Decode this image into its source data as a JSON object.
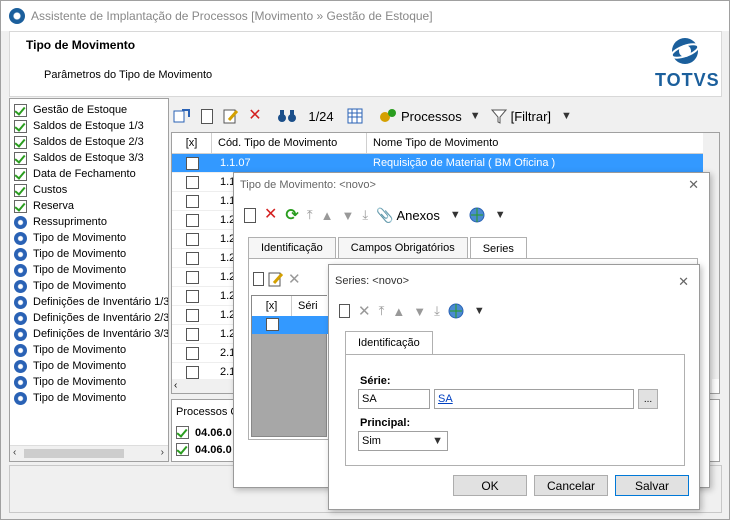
{
  "window": {
    "title": "Assistente de Implantação de Processos [Movimento » Gestão de Estoque]"
  },
  "header": {
    "title": "Tipo de Movimento",
    "subtitle": "Parâmetros do Tipo de Movimento",
    "logo": "TOTVS"
  },
  "tree": {
    "items": [
      {
        "label": "Gestão de Estoque",
        "icon": "check-icon"
      },
      {
        "label": "Saldos de Estoque 1/3",
        "icon": "check-icon"
      },
      {
        "label": "Saldos de Estoque 2/3",
        "icon": "check-icon"
      },
      {
        "label": "Saldos de Estoque 3/3",
        "icon": "check-icon"
      },
      {
        "label": "Data de Fechamento",
        "icon": "check-icon"
      },
      {
        "label": "Custos",
        "icon": "check-icon"
      },
      {
        "label": "Reserva",
        "icon": "check-icon"
      },
      {
        "label": "Ressuprimento",
        "icon": "gear-icon"
      },
      {
        "label": "Tipo de Movimento",
        "icon": "gear-icon"
      },
      {
        "label": "Tipo de Movimento",
        "icon": "gear-icon"
      },
      {
        "label": "Tipo de Movimento",
        "icon": "gear-icon"
      },
      {
        "label": "Tipo de Movimento",
        "icon": "gear-icon"
      },
      {
        "label": "Definições de Inventário 1/3",
        "icon": "gear-icon"
      },
      {
        "label": "Definições de Inventário 2/3",
        "icon": "gear-icon"
      },
      {
        "label": "Definições de Inventário 3/3",
        "icon": "gear-icon"
      },
      {
        "label": "Tipo de Movimento",
        "icon": "gear-icon"
      },
      {
        "label": "Tipo de Movimento",
        "icon": "gear-icon"
      },
      {
        "label": "Tipo de Movimento",
        "icon": "gear-icon"
      },
      {
        "label": "Tipo de Movimento",
        "icon": "gear-icon"
      }
    ]
  },
  "toolbar": {
    "counter": "1/24",
    "processos": "Processos",
    "filtrar": "[Filtrar]"
  },
  "grid": {
    "headers": [
      "[x]",
      "Cód. Tipo de Movimento",
      "Nome Tipo de Movimento"
    ],
    "rows": [
      {
        "code": "1.1.07",
        "name": "Requisição de Material ( BM Oficina )"
      },
      {
        "code": "1.1",
        "name": ""
      },
      {
        "code": "1.1",
        "name": ""
      },
      {
        "code": "1.2",
        "name": ""
      },
      {
        "code": "1.2",
        "name": ""
      },
      {
        "code": "1.2",
        "name": ""
      },
      {
        "code": "1.2",
        "name": ""
      },
      {
        "code": "1.2",
        "name": ""
      },
      {
        "code": "1.2",
        "name": ""
      },
      {
        "code": "1.2",
        "name": ""
      },
      {
        "code": "2.1",
        "name": ""
      },
      {
        "code": "2.1",
        "name": ""
      }
    ]
  },
  "processes": {
    "label": "Processos C",
    "items": [
      "04.06.0",
      "04.06.0"
    ]
  },
  "dialog1": {
    "title": "Tipo de Movimento: <novo>",
    "anexos": "Anexos",
    "tabs": [
      "Identificação",
      "Campos Obrigatórios",
      "Series"
    ],
    "inner_headers": [
      "[x]",
      "Séri"
    ]
  },
  "dialog2": {
    "title": "Series: <novo>",
    "tab": "Identificação",
    "serie_label": "Série:",
    "serie_value": "SA",
    "serie_link": "SA",
    "ellipsis": "...",
    "principal_label": "Principal:",
    "principal_value": "Sim",
    "ok": "OK",
    "cancel": "Cancelar",
    "save": "Salvar"
  },
  "colors": {
    "selection": "#3399ff",
    "brand": "#1b5f9c",
    "error": "#d42020",
    "ok": "#2a9d1f"
  }
}
